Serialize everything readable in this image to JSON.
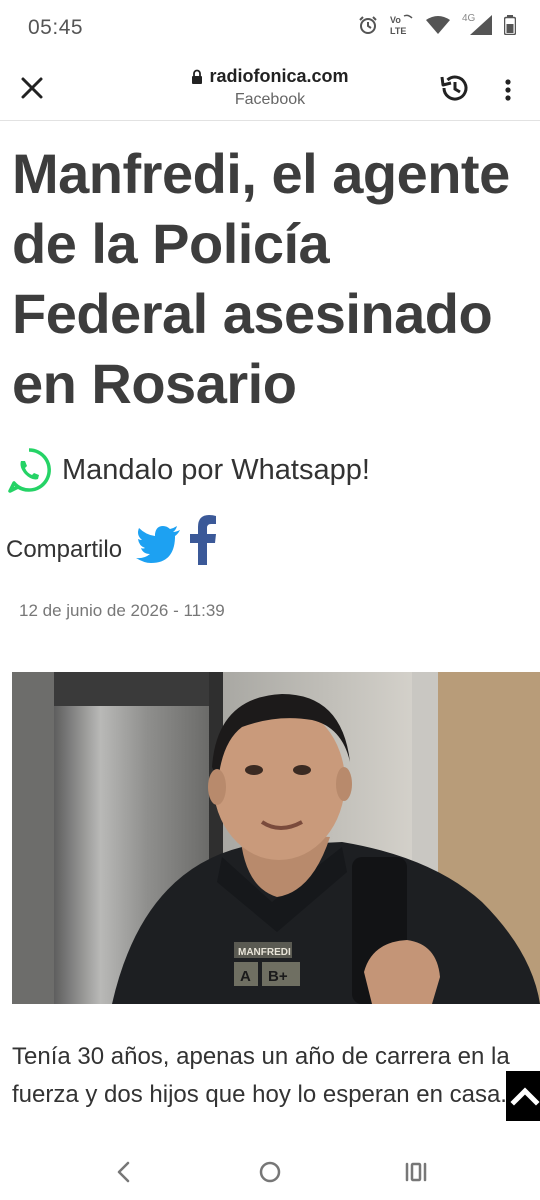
{
  "status_bar": {
    "time": "05:45",
    "network_badge": "4G",
    "volte_line1": "Vo",
    "volte_line2": "LTE",
    "icons": [
      "alarm-icon",
      "volte-icon",
      "wifi-icon",
      "signal-icon",
      "battery-icon"
    ]
  },
  "toolbar": {
    "url": "radiofonica.com",
    "subtitle": "Facebook",
    "icons": [
      "close-icon",
      "lock-icon",
      "history-icon",
      "more-vert-icon"
    ]
  },
  "article": {
    "headline_lines": [
      "Manfredi, el agente",
      "de la Policía",
      "Federal asesinado",
      "en Rosario"
    ],
    "whatsapp_text": "Mandalo por Whatsapp!",
    "share_label": "Compartilo",
    "date": "12 de junio de 2026 - 11:39",
    "vest_name": "MANFREDI",
    "vest_blood_a": "A",
    "vest_blood_b": "B+",
    "body_lines": [
      "Tenía 30 años, apenas un año de carrera en la",
      "fuerza y dos hijos que hoy lo esperan en casa."
    ]
  },
  "colors": {
    "whatsapp": "#25D366",
    "twitter": "#1DA1F2",
    "facebook": "#3B5998",
    "headline": "#3d3d3d"
  }
}
